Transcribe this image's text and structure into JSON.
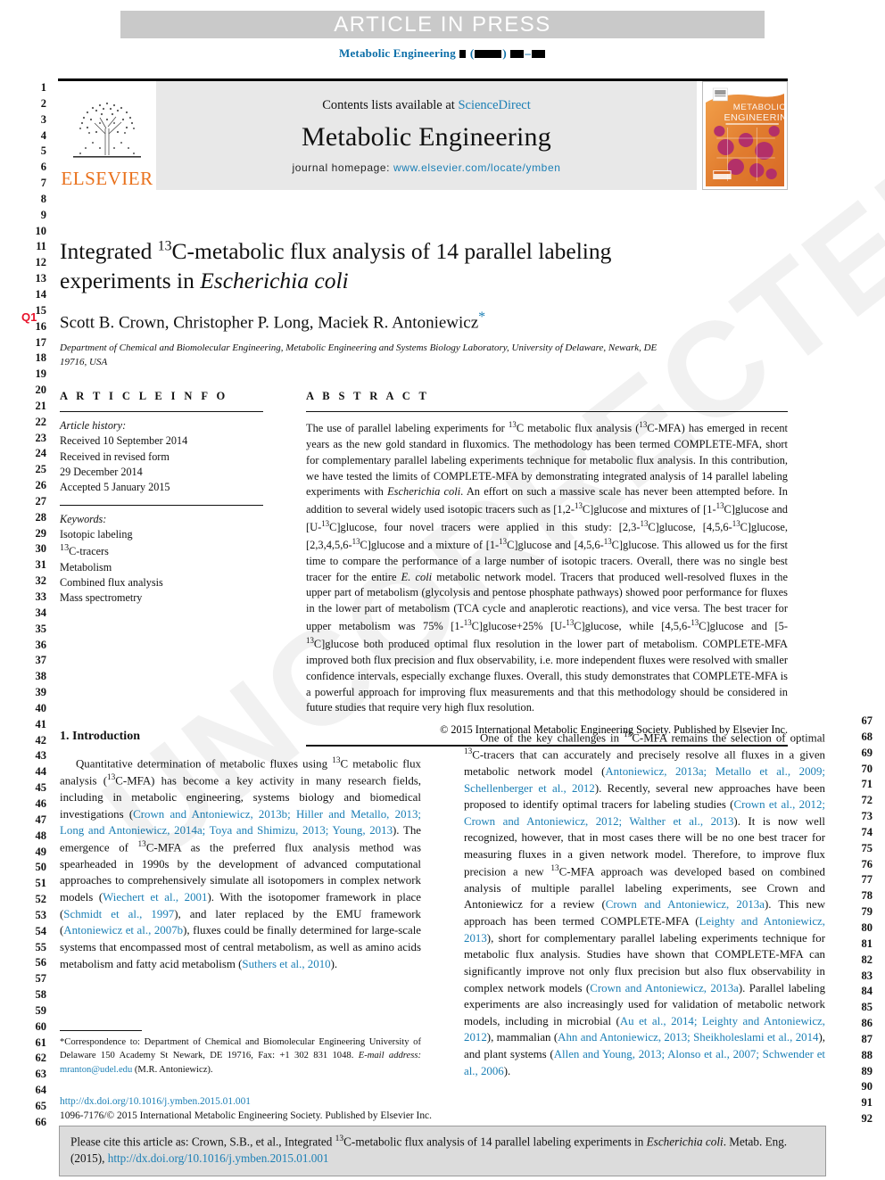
{
  "banner": {
    "text": "ARTICLE IN PRESS"
  },
  "running_head": {
    "journal": "Metabolic Engineering",
    "placeholder_note": "volume/issue/pages redacted blocks"
  },
  "masthead": {
    "contents_prefix": "Contents lists available at ",
    "contents_link": "ScienceDirect",
    "journal_title": "Metabolic Engineering",
    "homepage_prefix": "journal homepage: ",
    "homepage_url": "www.elsevier.com/locate/ymben",
    "publisher_logo_text": "ELSEVIER",
    "cover_title_line1": "METABOLIC",
    "cover_title_line2": "ENGINEERING"
  },
  "title": {
    "part1": "Integrated ",
    "sup1": "13",
    "part2": "C-metabolic flux analysis of 14 parallel labeling experiments in ",
    "italic_species": "Escherichia coli"
  },
  "authors": {
    "names": "Scott B. Crown, Christopher P. Long, Maciek R. Antoniewicz",
    "corresponding_mark": "*"
  },
  "affiliation": "Department of Chemical and Biomolecular Engineering, Metabolic Engineering and Systems Biology Laboratory, University of Delaware, Newark, DE 19716, USA",
  "article_info": {
    "label": "A R T I C L E   I N F O",
    "history_heading": "Article history:",
    "history": [
      "Received 10 September 2014",
      "Received in revised form",
      "29 December 2014",
      "Accepted 5 January 2015"
    ],
    "keywords_heading": "Keywords:",
    "keywords": [
      "Isotopic labeling",
      "13C-tracers",
      "Metabolism",
      "Combined flux analysis",
      "Mass spectrometry"
    ]
  },
  "abstract": {
    "label": "A B S T R A C T",
    "text_segments": [
      "The use of parallel labeling experiments for ",
      "C metabolic flux analysis (",
      "C-MFA) has emerged in recent years as the new gold standard in fluxomics. The methodology has been termed COMPLETE-MFA, short for complementary parallel labeling experiments technique for metabolic flux analysis. In this contribution, we have tested the limits of COMPLETE-MFA by demonstrating integrated analysis of 14 parallel labeling experiments with ",
      "Escherichia coli",
      ". An effort on such a massive scale has never been attempted before. In addition to several widely used isotopic tracers such as [1,2-",
      "C]glucose and mixtures of [1-",
      "C]glucose and [U-",
      "C]glucose, four novel tracers were applied in this study: [2,3-",
      "C]glucose, [4,5,6-",
      "C]glucose, [2,3,4,5,6-",
      "C]glucose and a mixture of [1-",
      "C]glucose and [4,5,6-",
      "C]glucose. This allowed us for the first time to compare the performance of a large number of isotopic tracers. Overall, there was no single best tracer for the entire ",
      "E. coli",
      " metabolic network model. Tracers that produced well-resolved fluxes in the upper part of metabolism (glycolysis and pentose phosphate pathways) showed poor performance for fluxes in the lower part of metabolism (TCA cycle and anaplerotic reactions), and vice versa. The best tracer for upper metabolism was 75% [1-",
      "C]glucose+25% [U-",
      "C]glucose, while [4,5,6-",
      "C]glucose and [5-",
      "C]glucose both produced optimal flux resolution in the lower part of metabolism. COMPLETE-MFA improved both flux precision and flux observability, i.e. more independent fluxes were resolved with smaller confidence intervals, especially exchange fluxes. Overall, this study demonstrates that COMPLETE-MFA is a powerful approach for improving flux measurements and that this methodology should be considered in future studies that require very high flux resolution."
    ],
    "copyright": "© 2015 International Metabolic Engineering Society. Published by Elsevier Inc."
  },
  "body": {
    "section1_heading": "1.  Introduction",
    "left_para1": {
      "s1": "Quantitative determination of metabolic fluxes using ",
      "sup1": "13",
      "s2": "C metabolic flux analysis (",
      "sup2": "13",
      "s3": "C-MFA) has become a key activity in many research fields, including in metabolic engineering, systems biology and biomedical investigations (",
      "cite1": "Crown and Antoniewicz, 2013b; Hiller and Metallo, 2013; Long and Antoniewicz, 2014a; Toya and Shimizu, 2013; Young, 2013",
      "s4": "). The emergence of ",
      "sup3": "13",
      "s5": "C-MFA as the preferred flux analysis method was spearheaded in 1990s by the development of advanced computational approaches to comprehensively simulate all isotopomers in complex network models (",
      "cite2": "Wiechert et al., 2001",
      "s6": "). With the isotopomer framework in place (",
      "cite3": "Schmidt et al., 1997",
      "s7": "), and later replaced by the EMU framework (",
      "cite4": "Antoniewicz et al., 2007b",
      "s8": "), fluxes could be finally determined for large-scale systems that encompassed most of central metabolism, as well as amino acids metabolism and fatty acid metabolism (",
      "cite5": "Suthers et al., 2010",
      "s9": ")."
    },
    "right_para1": {
      "s1": "One of the key challenges in ",
      "sup1": "13",
      "s2": "C-MFA remains the selection of optimal ",
      "sup2": "13",
      "s3": "C-tracers that can accurately and precisely resolve all fluxes in a given metabolic network model (",
      "cite1": "Antoniewicz, 2013a; Metallo et al., 2009; Schellenberger et al., 2012",
      "s4": "). Recently, several new approaches have been proposed to identify optimal tracers for labeling studies (",
      "cite2": "Crown et al., 2012; Crown and Antoniewicz, 2012; Walther et al., 2013",
      "s5": "). It is now well recognized, however, that in most cases there will be no one best tracer for measuring fluxes in a given network model. Therefore, to improve flux precision a new ",
      "sup3": "13",
      "s6": "C-MFA approach was developed based on combined analysis of multiple parallel labeling experiments, see Crown and Antoniewicz for a review (",
      "cite3": "Crown and Antoniewicz, 2013a",
      "s7": "). This new approach has been termed COMPLETE-MFA (",
      "cite4": "Leighty and Antoniewicz, 2013",
      "s8": "), short for complementary parallel labeling experiments technique for metabolic flux analysis. Studies have shown that COMPLETE-MFA can significantly improve not only flux precision but also flux observability in complex network models (",
      "cite5": "Crown and Antoniewicz, 2013a",
      "s9": "). Parallel labeling experiments are also increasingly used for validation of metabolic network models, including in microbial (",
      "cite6": "Au et al., 2014; Leighty and Antoniewicz, 2012",
      "s10": "), mammalian (",
      "cite7": "Ahn and Antoniewicz, 2013; Sheikholeslami et al., 2014",
      "s11": "), and plant systems (",
      "cite8": "Allen and Young, 2013; Alonso et al., 2007; Schwender et al., 2006",
      "s12": ")."
    }
  },
  "footnote": {
    "s1": "*Correspondence to: Department of Chemical and Biomolecular Engineering University of Delaware 150 Academy St Newark, DE 19716, Fax: +1 302 831 1048.",
    "email_label": "E-mail address:",
    "email": "mranton@udel.edu",
    "email_suffix": "(M.R. Antoniewicz)."
  },
  "doi_block": {
    "doi_url": "http://dx.doi.org/10.1016/j.ymben.2015.01.001",
    "issn_line": "1096-7176/© 2015 International Metabolic Engineering Society. Published by Elsevier Inc."
  },
  "cite_box": {
    "s1": "Please cite this article as: Crown, S.B., et al., Integrated ",
    "sup1": "13",
    "s2": "C-metabolic flux analysis of 14 parallel labeling experiments in ",
    "species": "Escherichia coli",
    "s3": ". Metab. Eng. (2015), ",
    "link": "http://dx.doi.org/10.1016/j.ymben.2015.01.001"
  },
  "line_numbers": {
    "left_start": 1,
    "left_end": 66,
    "right_start": 67,
    "right_end": 92,
    "query_marker": "Q1"
  },
  "watermark": {
    "text": "UNCORRECTED PROOF"
  },
  "colors": {
    "link": "#1b7fb5",
    "banner_bg": "#c9c9c9",
    "masthead_bg": "#e8e8e8",
    "elsevier_orange": "#e9711c",
    "query_red": "#e8122a"
  }
}
